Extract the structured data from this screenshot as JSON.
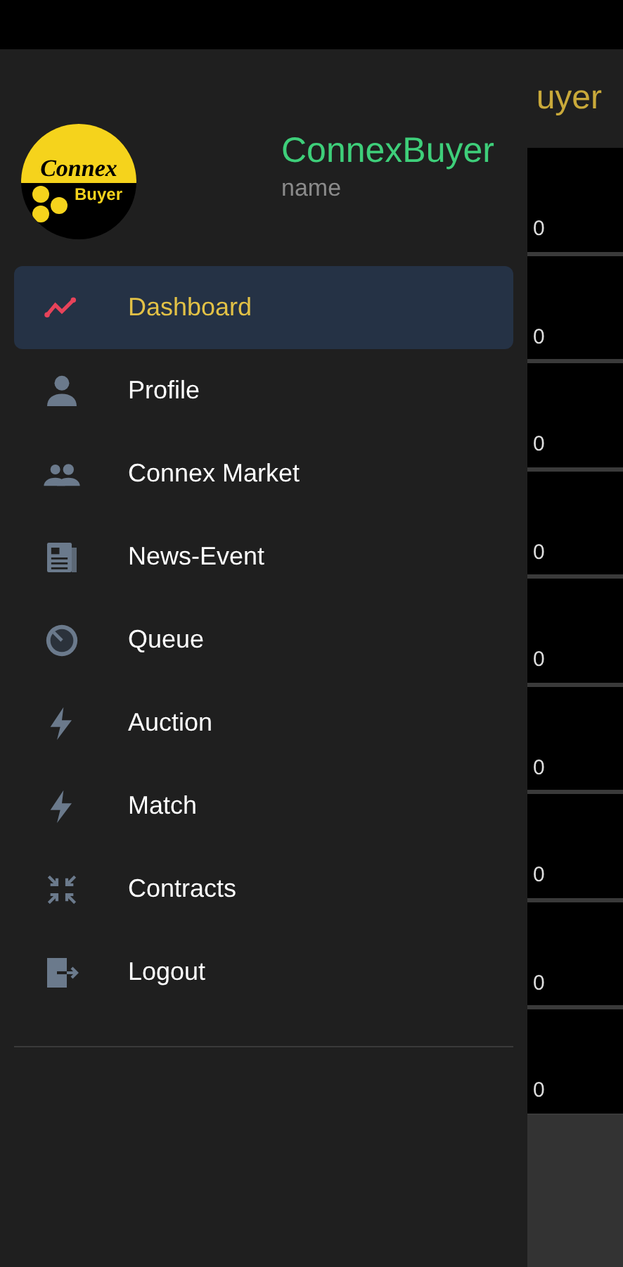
{
  "background": {
    "header_title": "uyer",
    "rows": [
      "0",
      "0",
      "0",
      "0",
      "0",
      "0",
      "0",
      "0",
      "0"
    ]
  },
  "drawer": {
    "logo": {
      "line_1": "Connex",
      "line_2": "Buyer"
    },
    "app_name": "ConnexBuyer",
    "user_name": "name",
    "items": [
      {
        "label": "Dashboard",
        "selected": true
      },
      {
        "label": "Profile",
        "selected": false
      },
      {
        "label": "Connex Market",
        "selected": false
      },
      {
        "label": "News-Event",
        "selected": false
      },
      {
        "label": "Queue",
        "selected": false
      },
      {
        "label": "Auction",
        "selected": false
      },
      {
        "label": "Match",
        "selected": false
      },
      {
        "label": "Contracts",
        "selected": false
      },
      {
        "label": "Logout",
        "selected": false
      }
    ]
  }
}
